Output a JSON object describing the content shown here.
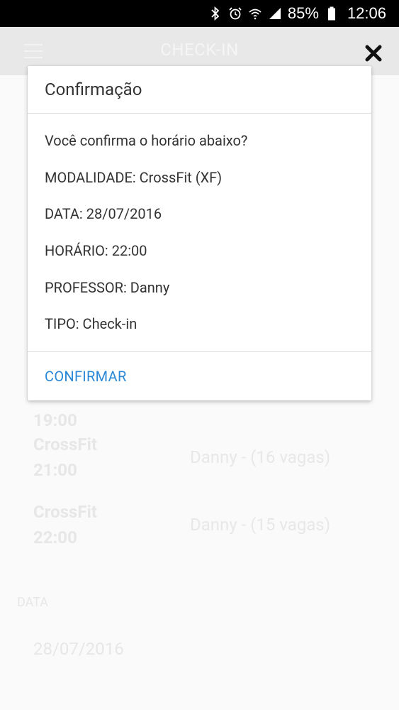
{
  "status_bar": {
    "battery": "85%",
    "time": "12:06"
  },
  "app_bar": {
    "title": "CHECK-IN"
  },
  "background_list": {
    "rows": [
      {
        "name": "",
        "time": "19:00",
        "info": ""
      },
      {
        "name": "CrossFit",
        "time": "21:00",
        "info": "Danny - (16 vagas)"
      },
      {
        "name": "CrossFit",
        "time": "22:00",
        "info": "Danny - (15 vagas)"
      }
    ],
    "date_label": "DATA",
    "date_value": "28/07/2016"
  },
  "dialog": {
    "title": "Confirmação",
    "question": "Você confirma o horário abaixo?",
    "modalidade": "MODALIDADE: CrossFit (XF)",
    "data": "DATA: 28/07/2016",
    "horario": "HORÁRIO: 22:00",
    "professor": "PROFESSOR: Danny",
    "tipo": "TIPO: Check-in",
    "confirm_label": "CONFIRMAR"
  },
  "colors": {
    "accent": "#2a88d6",
    "status_bar": "#000000",
    "app_bar": "#ededed"
  },
  "icons": [
    "bluetooth-icon",
    "alarm-icon",
    "wifi-icon",
    "signal-icon",
    "battery-icon",
    "menu-icon",
    "close-icon"
  ]
}
